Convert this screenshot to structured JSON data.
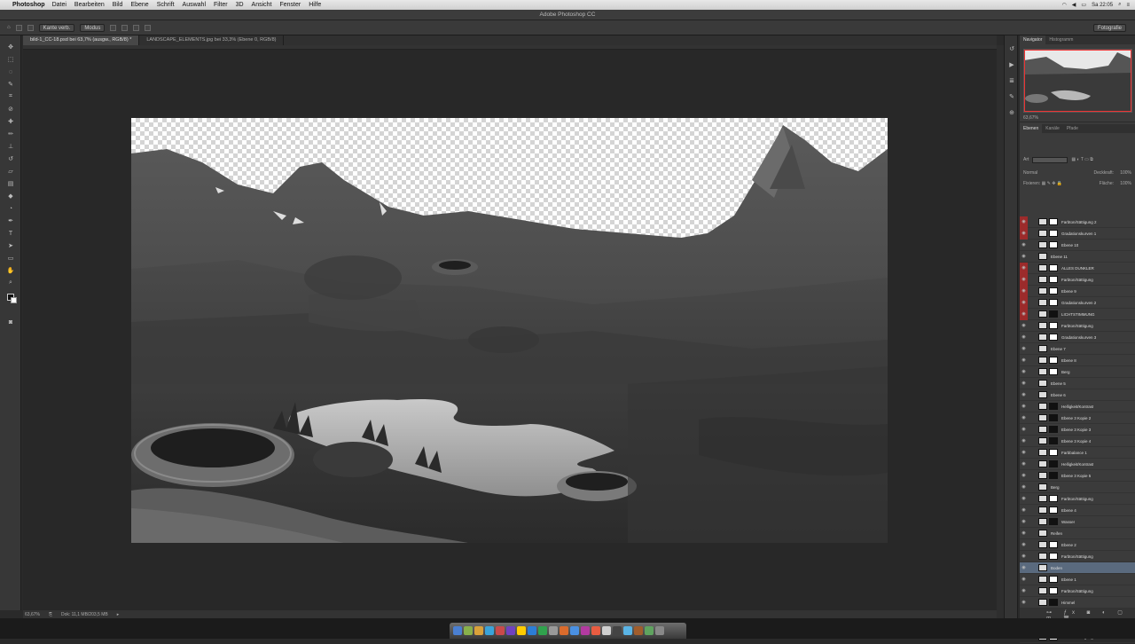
{
  "menubar": {
    "app": "Photoshop",
    "items": [
      "Datei",
      "Bearbeiten",
      "Bild",
      "Ebene",
      "Schrift",
      "Auswahl",
      "Filter",
      "3D",
      "Ansicht",
      "Fenster",
      "Hilfe"
    ],
    "clock": "Sa 22:05"
  },
  "window": {
    "title": "Adobe Photoshop CC"
  },
  "options_bar": {
    "preset": "Kante verb.",
    "select": "Modus",
    "workspace": "Fotografie"
  },
  "document_tabs": [
    {
      "label": "bild-1_CC-18.psd bei 63,7% (ausgw., RGB/8) *",
      "active": true
    },
    {
      "label": "LANDSCAPE_ELEMENTS.jpg bei 33,3% (Ebene 0, RGB/8)",
      "active": false
    }
  ],
  "status_bar": {
    "zoom": "63,67%",
    "doc_size": "Dok: 11,1 MB/203,5 MB"
  },
  "panels": {
    "navigator_tabs": [
      "Navigator",
      "Histogramm"
    ],
    "zoom_value": "63,67%",
    "layers_tabs": [
      "Ebenen",
      "Kanäle",
      "Pfade"
    ],
    "filter_label": "Art",
    "blend_mode": "Normal",
    "opacity_label": "Deckkraft:",
    "opacity_value": "100%",
    "fill_label": "Fläche:",
    "fill_value": "100%",
    "lock_label": "Fixieren:"
  },
  "layers": [
    {
      "name": "Farbton/Sättigung 2",
      "red": true,
      "mask": "white"
    },
    {
      "name": "Gradationskurven 1",
      "red": true,
      "mask": "white"
    },
    {
      "name": "Ebene 10",
      "red": false,
      "mask": "white"
    },
    {
      "name": "Ebene 11",
      "red": false,
      "mask": "none"
    },
    {
      "name": "ALLES DUNKLER",
      "red": true,
      "mask": "white"
    },
    {
      "name": "Farbton/Sättigung",
      "red": true,
      "mask": "white"
    },
    {
      "name": "Ebene 9",
      "red": true,
      "mask": "white"
    },
    {
      "name": "Gradationskurven 2",
      "red": true,
      "mask": "white"
    },
    {
      "name": "LICHTSTIMMUNG",
      "red": true,
      "mask": "dark"
    },
    {
      "name": "Farbton/Sättigung",
      "red": false,
      "mask": "white"
    },
    {
      "name": "Gradationskurven 3",
      "red": false,
      "mask": "white"
    },
    {
      "name": "Ebene 7",
      "red": false,
      "mask": "none"
    },
    {
      "name": "Ebene 8",
      "red": false,
      "mask": "white"
    },
    {
      "name": "Berg",
      "red": false,
      "mask": "white"
    },
    {
      "name": "Ebene 5",
      "red": false,
      "mask": "none"
    },
    {
      "name": "Ebene 6",
      "red": false,
      "mask": "none"
    },
    {
      "name": "Helligkeit/Kontrast",
      "red": false,
      "mask": "dark"
    },
    {
      "name": "Ebene 3 Kopie 2",
      "red": false,
      "mask": "dark"
    },
    {
      "name": "Ebene 3 Kopie 3",
      "red": false,
      "mask": "dark"
    },
    {
      "name": "Ebene 3 Kopie 4",
      "red": false,
      "mask": "dark"
    },
    {
      "name": "Farbbalance 1",
      "red": false,
      "mask": "white"
    },
    {
      "name": "Helligkeit/Kontrast",
      "red": false,
      "mask": "dark"
    },
    {
      "name": "Ebene 3 Kopie 5",
      "red": false,
      "mask": "dark"
    },
    {
      "name": "Berg",
      "red": false,
      "mask": "none"
    },
    {
      "name": "Farbton/Sättigung",
      "red": false,
      "mask": "white"
    },
    {
      "name": "Ebene 4",
      "red": false,
      "mask": "white"
    },
    {
      "name": "Wasser",
      "red": false,
      "mask": "dark"
    },
    {
      "name": "Reifen",
      "red": false,
      "mask": "none"
    },
    {
      "name": "Ebene 2",
      "red": false,
      "mask": "white"
    },
    {
      "name": "Farbton/Sättigung",
      "red": false,
      "mask": "white"
    },
    {
      "name": "Boden",
      "red": false,
      "mask": "none",
      "selected": true
    },
    {
      "name": "Ebene 1",
      "red": false,
      "mask": "white"
    },
    {
      "name": "Farbton/Sättigung",
      "red": false,
      "mask": "white"
    },
    {
      "name": "Himmel",
      "red": false,
      "mask": "dark"
    },
    {
      "name": "Gradationskurven 4",
      "red": false,
      "mask": "white"
    },
    {
      "name": "Ebene 0 Kopie",
      "red": false,
      "mask": "dark"
    },
    {
      "name": "Farbton/Sättigung 3",
      "red": false,
      "mask": "white"
    }
  ],
  "colors": {
    "chrome": "#3b3b3b",
    "canvas_bg": "#282828",
    "selected_layer": "#5a6a7e",
    "red_flag": "#9c2b2b"
  },
  "dock_icon_colors": [
    "#4a7fd1",
    "#88b04b",
    "#d9a13a",
    "#3aa3d9",
    "#c94a4a",
    "#6f42c1",
    "#ffcc00",
    "#2c7dd6",
    "#30a24d",
    "#999999",
    "#da6b2c",
    "#4a90e2",
    "#b23aa0",
    "#e85c41",
    "#cfcfcf",
    "#444444",
    "#5ab4e5",
    "#a05d2c",
    "#5fa35f",
    "#888888"
  ]
}
